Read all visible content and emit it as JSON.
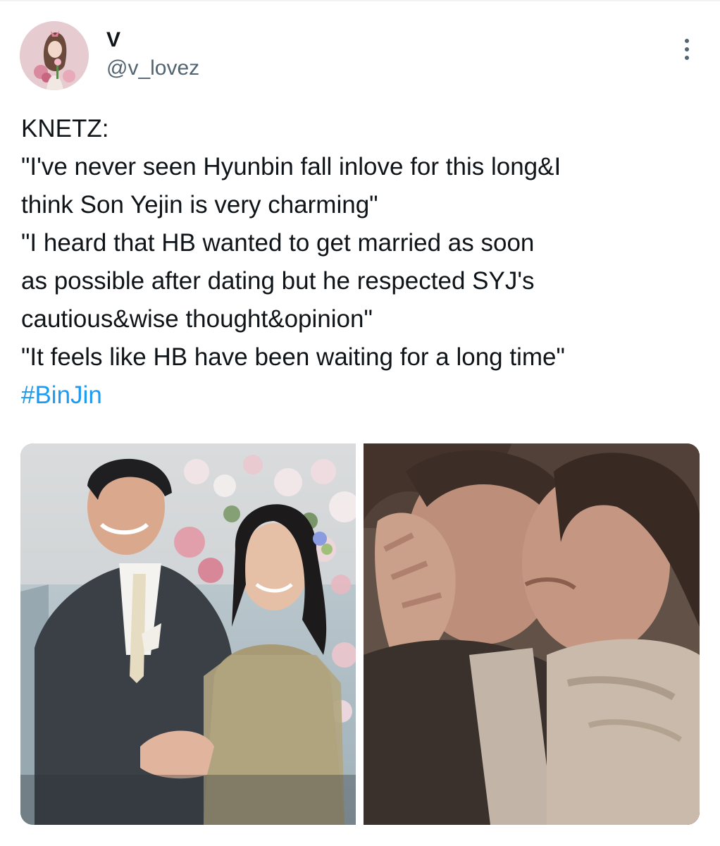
{
  "tweet": {
    "author": {
      "display_name": "V",
      "handle": "@v_lovez",
      "avatar": "profile-avatar"
    },
    "more_icon": "more-options-icon",
    "text_lines": [
      "KNETZ:",
      "\"I've never seen Hyunbin fall inlove for this long&I",
      "think Son Yejin is very charming\"",
      "\"I heard that HB wanted to get married as soon",
      "as possible after dating but he respected SYJ's",
      "cautious&wise thought&opinion\"",
      "\"It feels like HB have been waiting for a long time\""
    ],
    "hashtag": "#BinJin",
    "media": [
      {
        "alt": "wedding-photo"
      },
      {
        "alt": "closeup-photo"
      }
    ]
  },
  "colors": {
    "text": "#0f1419",
    "secondary": "#536471",
    "link": "#1d9bf0",
    "divider": "#eff3f4"
  }
}
